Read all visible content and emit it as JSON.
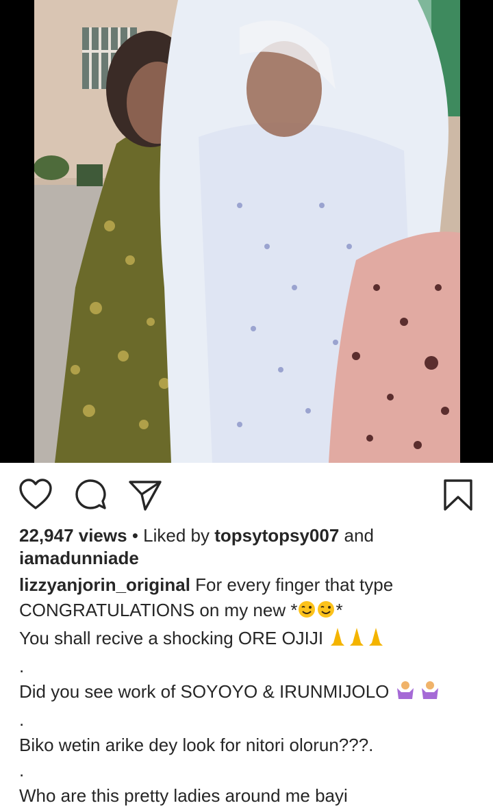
{
  "post": {
    "media": {
      "type": "video",
      "description_icon": "video-frame"
    },
    "actions": {
      "like_icon": "heart-icon",
      "comment_icon": "comment-icon",
      "share_icon": "send-icon",
      "save_icon": "bookmark-icon"
    },
    "stats": {
      "views": "22,947 views",
      "separator": "•",
      "liked_by_prefix": "Liked by",
      "liked_by_user": "topsytopsy007",
      "liked_by_and": "and",
      "liked_by_other": "iamadunniade"
    },
    "caption": {
      "username": "lizzyanjorin_original",
      "line1": "For every finger that type",
      "line2": "CONGRATULATIONS on my new *",
      "line2_end": "*",
      "line3": "You shall recive a shocking ORE OJIJI",
      "dot1": ".",
      "line4": "Did you see work of SOYOYO & IRUNMIJOLO",
      "dot2": ".",
      "line5": "Biko wetin arike dey look for nitori olorun???.",
      "dot3": ".",
      "line6": "Who are this pretty ladies around me bayi"
    },
    "colors": {
      "text": "#262626",
      "background": "#ffffff"
    }
  }
}
